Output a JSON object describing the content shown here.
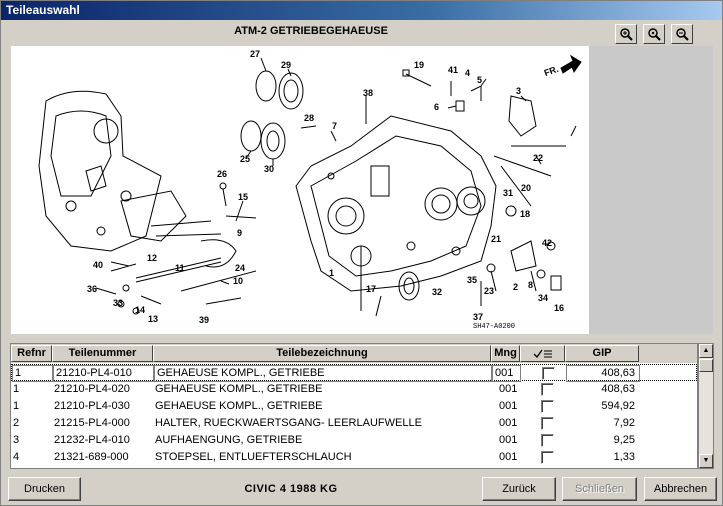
{
  "window": {
    "title": "Teileauswahl"
  },
  "diagram": {
    "title": "ATM-2 GETRIEBEGEHAEUSE",
    "direction_label": "FR.",
    "drawing_code": "SH47-A0200",
    "callouts": [
      "27",
      "29",
      "41",
      "4",
      "5",
      "19",
      "38",
      "6",
      "3",
      "FR.",
      "28",
      "25",
      "30",
      "7",
      "26",
      "15",
      "22",
      "20",
      "31",
      "18",
      "9",
      "21",
      "42",
      "40",
      "12",
      "11",
      "24",
      "10",
      "36",
      "33",
      "14",
      "13",
      "39",
      "17",
      "32",
      "35",
      "23",
      "2",
      "8",
      "34",
      "16",
      "37",
      "1"
    ]
  },
  "zoom": {
    "in_icon": "zoom-in-icon",
    "fit_icon": "zoom-fit-icon",
    "out_icon": "zoom-out-icon"
  },
  "table": {
    "headers": {
      "refnr": "Refnr",
      "teilenummer": "Teilenummer",
      "bezeichnung": "Teilebezeichnung",
      "mng": "Mng",
      "select_icon": "list-check-icon",
      "gip": "GIP"
    },
    "rows": [
      {
        "refnr": "1",
        "teilenummer": "21210-PL4-010",
        "bezeichnung": "GEHAEUSE KOMPL., GETRIEBE",
        "mng": "001",
        "gip": "408,63"
      },
      {
        "refnr": "1",
        "teilenummer": "21210-PL4-020",
        "bezeichnung": "GEHAEUSE KOMPL., GETRIEBE",
        "mng": "001",
        "gip": "408,63"
      },
      {
        "refnr": "1",
        "teilenummer": "21210-PL4-030",
        "bezeichnung": "GEHAEUSE KOMPL., GETRIEBE",
        "mng": "001",
        "gip": "594,92"
      },
      {
        "refnr": "2",
        "teilenummer": "21215-PL4-000",
        "bezeichnung": "HALTER, RUECKWAERTSGANG- LEERLAUFWELLE",
        "mng": "001",
        "gip": "7,92"
      },
      {
        "refnr": "3",
        "teilenummer": "21232-PL4-010",
        "bezeichnung": "AUFHAENGUNG, GETRIEBE",
        "mng": "001",
        "gip": "9,25"
      },
      {
        "refnr": "4",
        "teilenummer": "21321-689-000",
        "bezeichnung": "STOEPSEL, ENTLUEFTERSCHLAUCH",
        "mng": "001",
        "gip": "1,33"
      }
    ]
  },
  "footer": {
    "print_label": "Drucken",
    "vehicle": "CIVIC  4  1988  KG",
    "back_label": "Zurück",
    "close_label": "Schließen",
    "cancel_label": "Abbrechen"
  }
}
